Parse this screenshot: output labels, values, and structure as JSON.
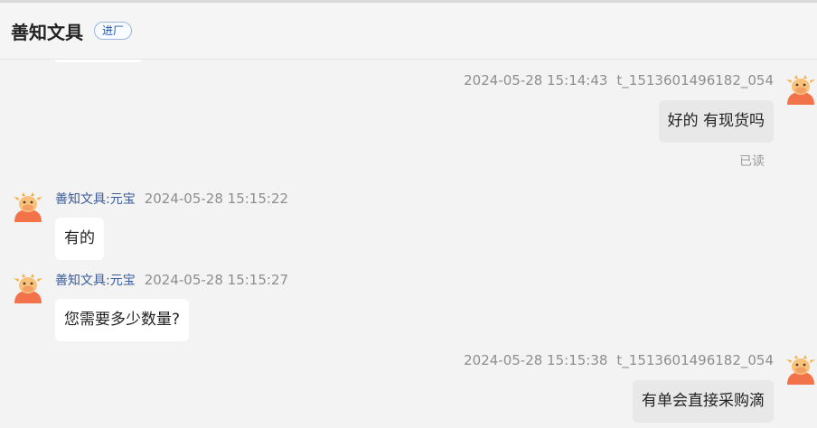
{
  "header": {
    "shop_name": "善知文具",
    "tag": "进厂"
  },
  "messages": [
    {
      "direction": "out",
      "time": "2024-05-28 15:14:43",
      "user": "t_1513601496182_054",
      "text": "好的 有现货吗",
      "status": "已读"
    },
    {
      "direction": "in",
      "sender": "善知文具:元宝",
      "time": "2024-05-28 15:15:22",
      "text": "有的"
    },
    {
      "direction": "in",
      "sender": "善知文具:元宝",
      "time": "2024-05-28 15:15:27",
      "text": "您需要多少数量?"
    },
    {
      "direction": "out",
      "time": "2024-05-28 15:15:38",
      "user": "t_1513601496182_054",
      "text": "有单会直接采购滴"
    }
  ],
  "colors": {
    "background": "#f3f3f3",
    "outgoing_bubble": "#e8e8e8",
    "incoming_bubble": "#ffffff",
    "sender_name": "#3a5c9a",
    "avatar_accent": "#f2734a"
  },
  "icons": {
    "avatar": "cow-mascot-avatar-icon"
  }
}
